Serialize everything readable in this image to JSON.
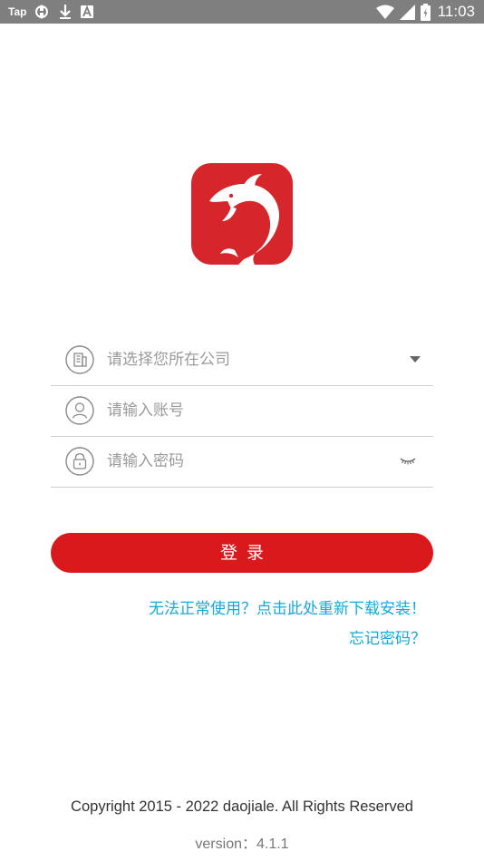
{
  "status_bar": {
    "tap_label": "Tap",
    "time": "11:03",
    "icons": [
      "sync-icon",
      "download-icon",
      "a-letter-icon",
      "wifi-icon",
      "cell-signal-icon",
      "battery-icon"
    ]
  },
  "logo": {
    "icon": "dolphin-icon",
    "color": "#d6262c"
  },
  "form": {
    "company": {
      "icon": "building-icon",
      "placeholder": "请选择您所在公司",
      "trailing_icon": "dropdown-arrow-icon"
    },
    "account": {
      "icon": "user-icon",
      "placeholder": "请输入账号"
    },
    "password": {
      "icon": "lock-icon",
      "placeholder": "请输入密码",
      "trailing_icon": "eye-closed-icon"
    }
  },
  "login_button": {
    "label": "登录",
    "color": "#d9191c"
  },
  "links": {
    "reinstall": "无法正常使用？点击此处重新下载安装！",
    "forgot_password": "忘记密码？",
    "color": "#16a9d6"
  },
  "footer": {
    "copyright": "Copyright 2015 - 2022 daojiale. All Rights Reserved",
    "version": "version：4.1.1"
  }
}
